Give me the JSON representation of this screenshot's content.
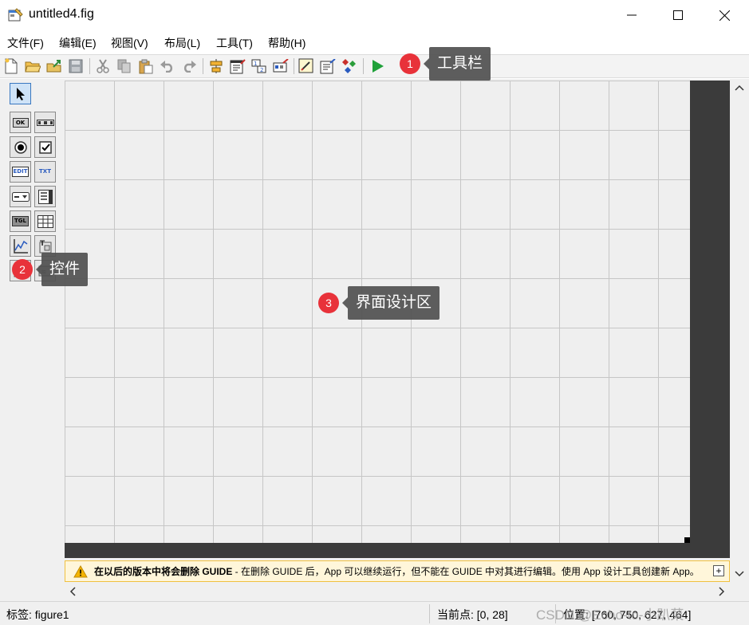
{
  "window": {
    "title": "untitled4.fig"
  },
  "menu": {
    "items": [
      "文件(F)",
      "编辑(E)",
      "视图(V)",
      "布局(L)",
      "工具(T)",
      "帮助(H)"
    ]
  },
  "toolbar": {
    "icons": [
      "new-figure-icon",
      "open-icon",
      "export-icon",
      "save-icon",
      "cut-icon",
      "copy-icon",
      "paste-icon",
      "undo-icon",
      "redo-icon",
      "align-objects-icon",
      "menu-editor-icon",
      "tab-order-icon",
      "toolbar-editor-icon",
      "editor-icon",
      "property-inspector-icon",
      "object-browser-icon",
      "run-icon"
    ]
  },
  "palette": {
    "tools": [
      "select-tool",
      "push-button",
      "slider",
      "radio-button",
      "check-box",
      "edit-text",
      "static-text",
      "popup-menu",
      "list-box",
      "toggle-button",
      "table",
      "axes",
      "panel",
      "button-group",
      "activex-control"
    ],
    "labels": {
      "push": "OK",
      "edit": "EDIT",
      "text": "TXT",
      "toggle": "TGL"
    }
  },
  "warning": {
    "bold": "在以后的版本中将会删除 GUIDE",
    "rest": " - 在删除 GUIDE 后，App 可以继续运行，但不能在 GUIDE 中对其进行编辑。使用 App 设计工具创建新 App。"
  },
  "status": {
    "tag": "标签: figure1",
    "current_point": "当前点:  [0, 28]",
    "position": "位置: [760, 750, 627, 464]"
  },
  "annotations": [
    {
      "number": "1",
      "label": "工具栏"
    },
    {
      "number": "2",
      "label": "控件"
    },
    {
      "number": "3",
      "label": "界面设计区"
    }
  ],
  "watermark": "CSDN @Echo-to-小趴菜",
  "colors": {
    "accent_run": "#1fa13a",
    "badge": "#e8323a",
    "dark_canvas_border": "#3b3b3b",
    "warning_bg": "#fff6da"
  }
}
